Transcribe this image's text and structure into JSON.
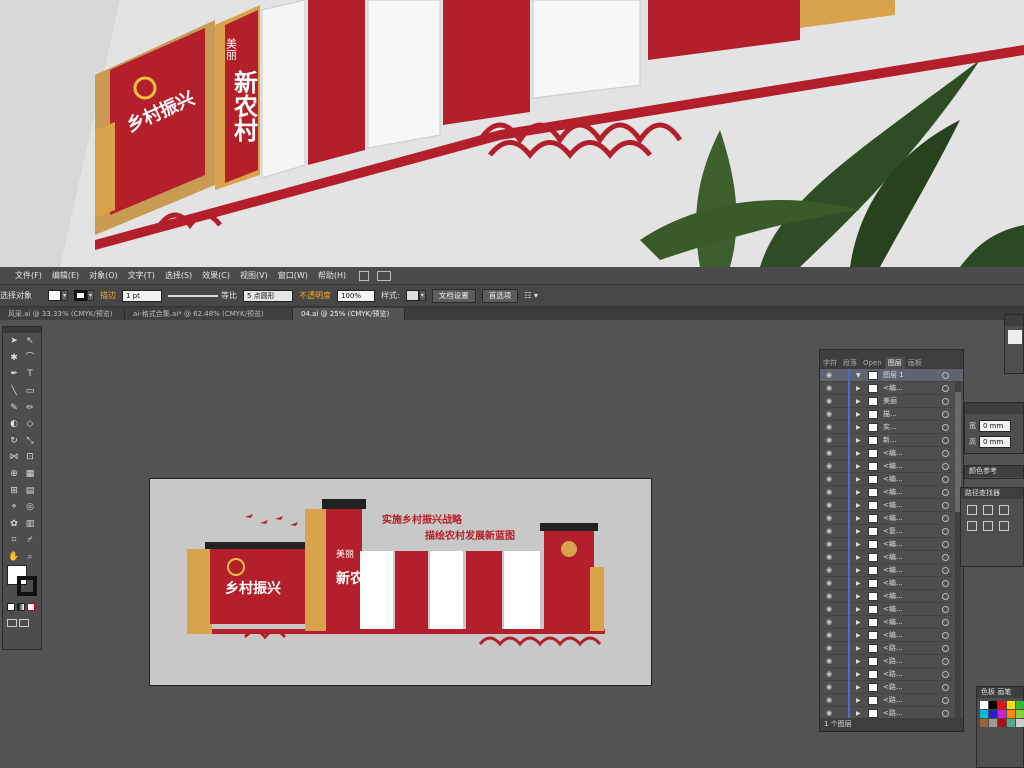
{
  "menu": {
    "items": [
      "文件(F)",
      "编辑(E)",
      "对象(O)",
      "文字(T)",
      "选择(S)",
      "效果(C)",
      "视图(V)",
      "窗口(W)",
      "帮助(H)"
    ]
  },
  "control": {
    "selection_label": "选择对象",
    "stroke_label": "描边",
    "stroke_weight": "1 pt",
    "stroke_style": "等比",
    "brush": "5 点圆形",
    "opacity_label": "不透明度",
    "opacity_value": "100%",
    "style_label": "样式:",
    "doc_settings": "文档设置",
    "preferences": "首选项"
  },
  "tabs": [
    {
      "label": "风采.ai @ 33.33% (CMYK/预览)",
      "active": false
    },
    {
      "label": "ai-格式合集.ai* @ 62.48% (CMYK/预览)",
      "active": false
    },
    {
      "label": "04.ai @ 25% (CMYK/预览)",
      "active": true
    }
  ],
  "artboard": {
    "headline_1": "实施乡村振兴战略",
    "headline_2": "描绘农村发展新蓝图",
    "panel_main": "乡村振兴",
    "panel_vertical_small": "美丽",
    "panel_vertical_big": "新农村"
  },
  "photo": {
    "panel_main": "乡村振兴",
    "panel_vertical_small": "美丽",
    "panel_vertical_big": "新农村"
  },
  "layers_panel": {
    "tabs": [
      "字符",
      "段落",
      "Open",
      "图层",
      "画板"
    ],
    "active_tab": "图层",
    "layers": [
      {
        "name": "图层 1",
        "selected": true
      },
      {
        "name": "<编...",
        "selected": false
      },
      {
        "name": "美丽",
        "selected": false
      },
      {
        "name": "描...",
        "selected": false
      },
      {
        "name": "实...",
        "selected": false
      },
      {
        "name": "新...",
        "selected": false
      },
      {
        "name": "<编...",
        "selected": false
      },
      {
        "name": "<编...",
        "selected": false
      },
      {
        "name": "<编...",
        "selected": false
      },
      {
        "name": "<编...",
        "selected": false
      },
      {
        "name": "<编...",
        "selected": false
      },
      {
        "name": "<编...",
        "selected": false
      },
      {
        "name": "<复...",
        "selected": false
      },
      {
        "name": "<编...",
        "selected": false
      },
      {
        "name": "<编...",
        "selected": false
      },
      {
        "name": "<编...",
        "selected": false
      },
      {
        "name": "<编...",
        "selected": false
      },
      {
        "name": "<编...",
        "selected": false
      },
      {
        "name": "<编...",
        "selected": false
      },
      {
        "name": "<编...",
        "selected": false
      },
      {
        "name": "<编...",
        "selected": false
      },
      {
        "name": "<路...",
        "selected": false
      },
      {
        "name": "<路...",
        "selected": false
      },
      {
        "name": "<路...",
        "selected": false
      },
      {
        "name": "<路...",
        "selected": false
      },
      {
        "name": "<路...",
        "selected": false
      },
      {
        "name": "<路...",
        "selected": false
      }
    ],
    "footer": "1 个图层"
  },
  "right_panels": {
    "transform_w": "宽",
    "transform_h": "高",
    "w_value": "0 mm",
    "h_value": "0 mm",
    "color_guide": "颜色参考",
    "pathfinder": "路径查找器",
    "swatches": "色板",
    "brushes": "画笔"
  },
  "colors": {
    "red": "#b3202c",
    "dark_red": "#8e1722",
    "gold": "#d9a34c",
    "cream": "#f3e6cc",
    "ui_bg": "#535353"
  }
}
